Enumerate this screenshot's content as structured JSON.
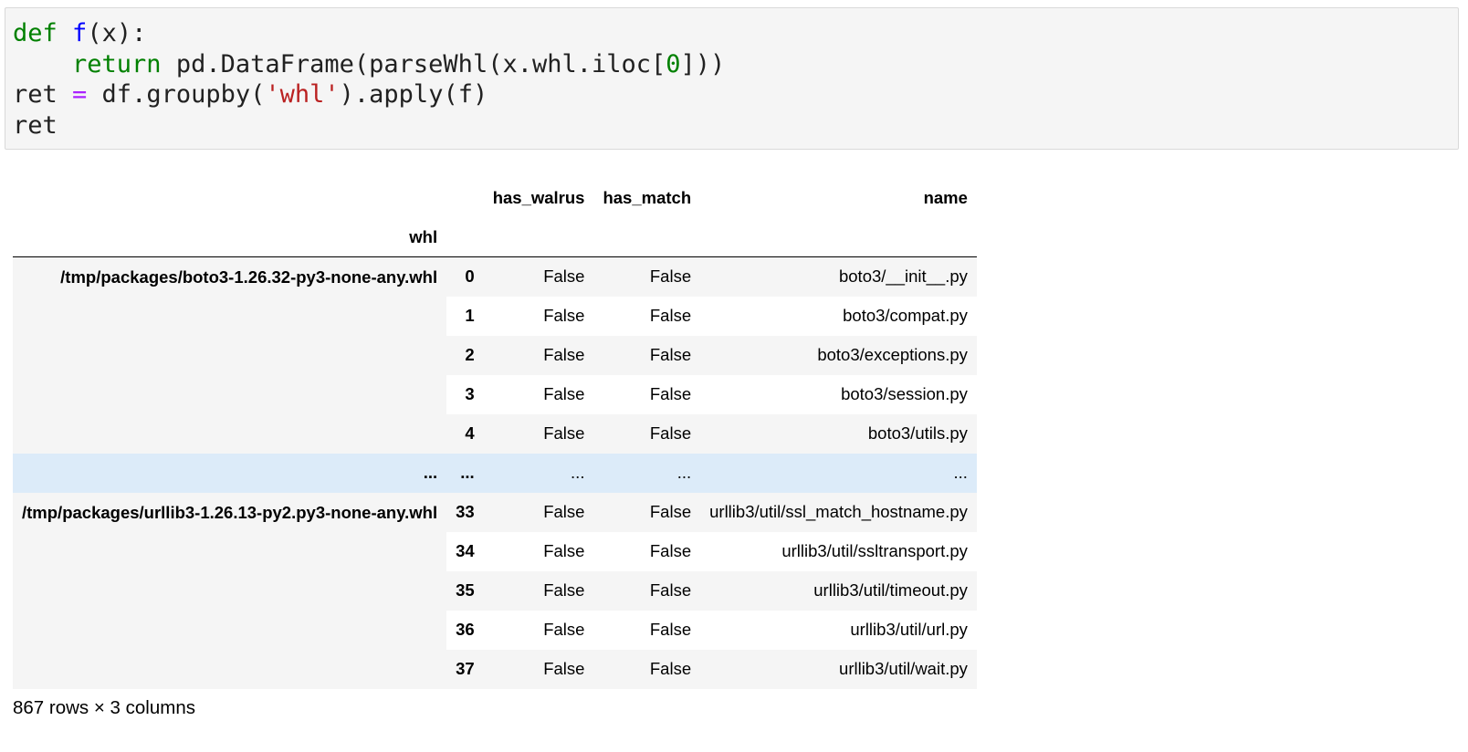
{
  "code_cell": {
    "lines": [
      [
        {
          "text": "def",
          "color": "#008000"
        },
        {
          "text": " ",
          "color": "#212121"
        },
        {
          "text": "f",
          "color": "#0000ff"
        },
        {
          "text": "(x):",
          "color": "#212121"
        }
      ],
      [
        {
          "text": "    ",
          "color": "#212121"
        },
        {
          "text": "return",
          "color": "#008000"
        },
        {
          "text": " pd.DataFrame(parseWhl(x.whl.iloc[",
          "color": "#212121"
        },
        {
          "text": "0",
          "color": "#008000"
        },
        {
          "text": "]))",
          "color": "#212121"
        }
      ],
      [
        {
          "text": "ret ",
          "color": "#212121"
        },
        {
          "text": "=",
          "color": "#aa22ff"
        },
        {
          "text": " df.groupby(",
          "color": "#212121"
        },
        {
          "text": "'whl'",
          "color": "#ba2121"
        },
        {
          "text": ").apply(f)",
          "color": "#212121"
        }
      ],
      [
        {
          "text": "ret",
          "color": "#212121"
        }
      ]
    ]
  },
  "dataframe": {
    "columns": [
      "has_walrus",
      "has_match",
      "name"
    ],
    "index_name": "whl",
    "groups": [
      {
        "label": "/tmp/packages/boto3-1.26.32-py3-none-any.whl",
        "rows": [
          {
            "idx": "0",
            "has_walrus": "False",
            "has_match": "False",
            "name": "boto3/__init__.py"
          },
          {
            "idx": "1",
            "has_walrus": "False",
            "has_match": "False",
            "name": "boto3/compat.py"
          },
          {
            "idx": "2",
            "has_walrus": "False",
            "has_match": "False",
            "name": "boto3/exceptions.py"
          },
          {
            "idx": "3",
            "has_walrus": "False",
            "has_match": "False",
            "name": "boto3/session.py"
          },
          {
            "idx": "4",
            "has_walrus": "False",
            "has_match": "False",
            "name": "boto3/utils.py"
          }
        ]
      },
      {
        "label": "/tmp/packages/urllib3-1.26.13-py2.py3-none-any.whl",
        "rows": [
          {
            "idx": "33",
            "has_walrus": "False",
            "has_match": "False",
            "name": "urllib3/util/ssl_match_hostname.py"
          },
          {
            "idx": "34",
            "has_walrus": "False",
            "has_match": "False",
            "name": "urllib3/util/ssltransport.py"
          },
          {
            "idx": "35",
            "has_walrus": "False",
            "has_match": "False",
            "name": "urllib3/util/timeout.py"
          },
          {
            "idx": "36",
            "has_walrus": "False",
            "has_match": "False",
            "name": "urllib3/util/url.py"
          },
          {
            "idx": "37",
            "has_walrus": "False",
            "has_match": "False",
            "name": "urllib3/util/wait.py"
          }
        ]
      }
    ],
    "ellipsis": "...",
    "ellipsis_color": "#dcebf9",
    "stripe_color": "#f5f5f5"
  },
  "shape_note": "867 rows × 3 columns"
}
